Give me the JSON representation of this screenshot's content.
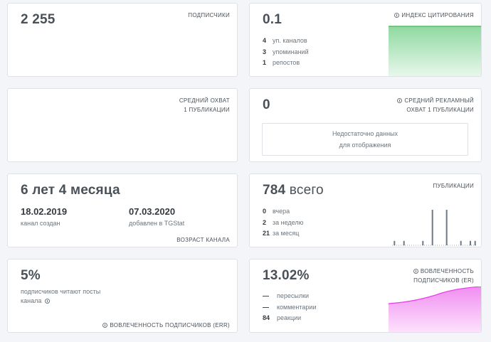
{
  "subscribers": {
    "value": "2 255",
    "label": "ПОДПИСЧИКИ"
  },
  "citation": {
    "value": "0.1",
    "label": "ИНДЕКС ЦИТИРОВАНИЯ",
    "rows": [
      {
        "n": "4",
        "text": "уп. каналов"
      },
      {
        "n": "3",
        "text": "упоминаний"
      },
      {
        "n": "1",
        "text": "репостов"
      }
    ],
    "color": "#3fb950"
  },
  "avg_reach": {
    "label_line1": "СРЕДНИЙ ОХВАТ",
    "label_line2": "1 ПУБЛИКАЦИИ"
  },
  "ad_reach": {
    "value": "0",
    "label_line1": "СРЕДНИЙ РЕКЛАМНЫЙ",
    "label_line2": "ОХВАТ 1 ПУБЛИКАЦИИ",
    "nodata_line1": "Недостаточно данных",
    "nodata_line2": "для отображения"
  },
  "age": {
    "value": "6 лет 4 месяца",
    "created_date": "18.02.2019",
    "created_label": "канал создан",
    "added_date": "07.03.2020",
    "added_label": "добавлен в TGStat",
    "label": "ВОЗРАСТ КАНАЛА"
  },
  "publications": {
    "value": "784",
    "unit": "всего",
    "label": "ПУБЛИКАЦИИ",
    "rows": [
      {
        "n": "0",
        "text": "вчера"
      },
      {
        "n": "2",
        "text": "за неделю"
      },
      {
        "n": "21",
        "text": "за месяц"
      }
    ],
    "bar_color": "#6c7a89",
    "bars": [
      1,
      0,
      1,
      0,
      0,
      0,
      1,
      0,
      8,
      0,
      0,
      8,
      0,
      0,
      1,
      0,
      1,
      1
    ]
  },
  "err": {
    "value": "5%",
    "text_line1": "подписчиков читают посты",
    "text_line2": "канала",
    "label": "ВОВЛЕЧЕННОСТЬ ПОДПИСЧИКОВ (ERR)"
  },
  "er": {
    "value": "13.02%",
    "label_line1": "ВОВЛЕЧЕННОСТЬ",
    "label_line2": "ПОДПИСЧИКОВ (ER)",
    "rows": [
      {
        "n": "—",
        "text": "пересылки"
      },
      {
        "n": "—",
        "text": "комментарии"
      },
      {
        "n": "84",
        "text": "реакции"
      }
    ],
    "color": "#e83ee8"
  }
}
